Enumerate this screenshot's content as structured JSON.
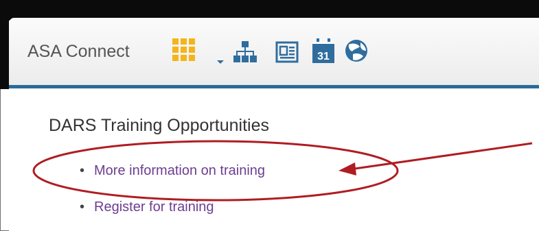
{
  "header": {
    "app_title": "ASA Connect",
    "icons": [
      {
        "name": "apps-grid-icon",
        "color": "#f5b41a"
      },
      {
        "name": "org-chart-icon",
        "color": "#2f6d9e"
      },
      {
        "name": "news-icon",
        "color": "#2f6d9e"
      },
      {
        "name": "calendar-icon",
        "color": "#2f6d9e",
        "text": "31"
      },
      {
        "name": "globe-icon",
        "color": "#2f6d9e"
      }
    ]
  },
  "main": {
    "section_title": "DARS Training Opportunities",
    "links": [
      {
        "label": "More information on training"
      },
      {
        "label": "Register for training"
      }
    ]
  },
  "colors": {
    "accent_bar": "#2b6b9a",
    "link": "#6c3d91",
    "annotation": "#b01c22",
    "icon_blue": "#2f6d9e",
    "icon_orange": "#f5b41a"
  }
}
